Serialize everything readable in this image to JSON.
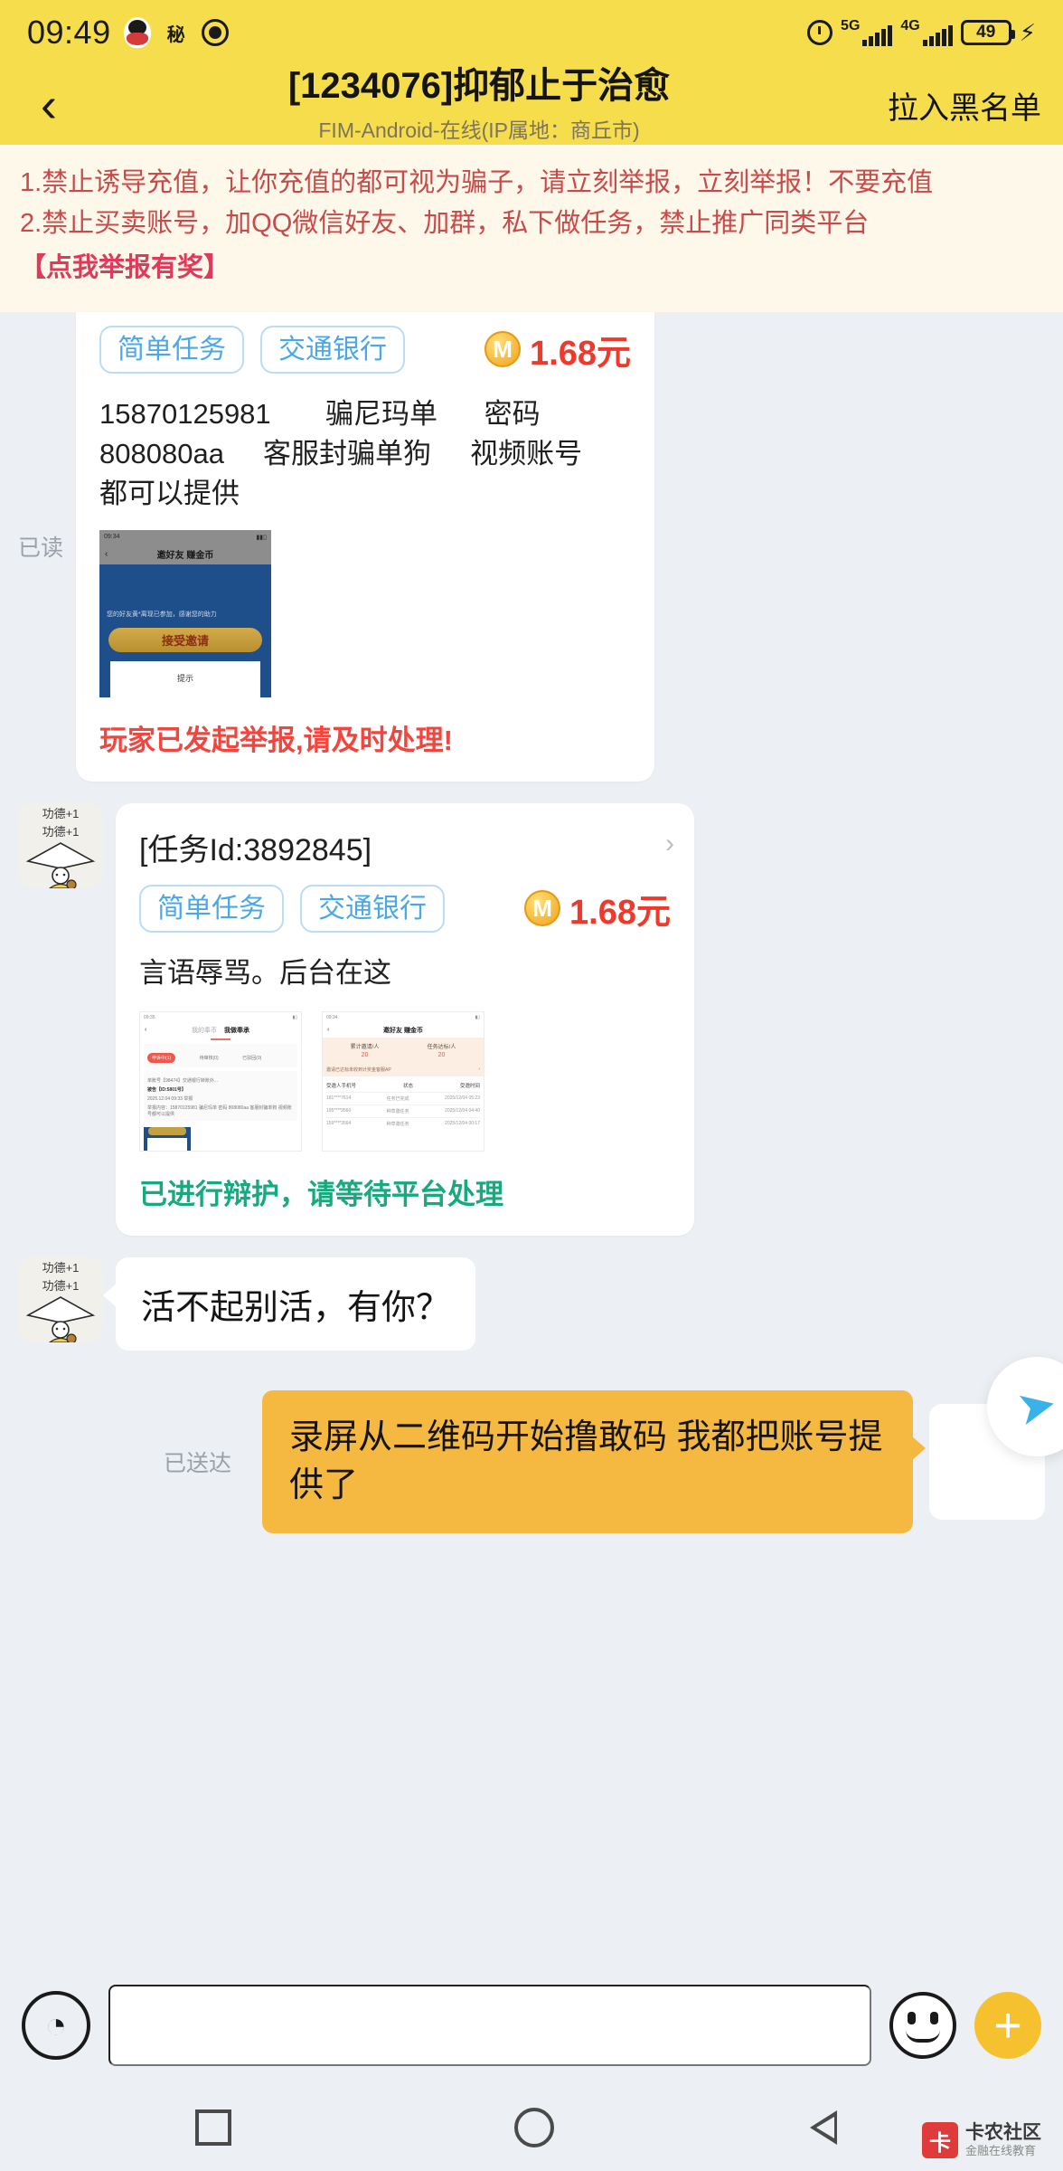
{
  "status_bar": {
    "time": "09:49",
    "icons_left": [
      "qq-icon",
      "secret-icon",
      "eye-icon"
    ],
    "secret_glyph": "秘",
    "alarm_icon": "alarm-icon",
    "network_5g": "5G",
    "network_4g": "4G",
    "battery_level": "49",
    "charging_glyph": "⚡"
  },
  "header": {
    "back_icon": "chevron-left-icon",
    "title": "[1234076]抑郁止于治愈",
    "subtitle": "FIM-Android-在线(IP属地：商丘市)",
    "blacklist_label": "拉入黑名单"
  },
  "notice": {
    "line1": "1.禁止诱导充值，让你充值的都可视为骗子，请立刻举报，立刻举报！不要充值",
    "line2": "2.禁止买卖账号，加QQ微信好友、加群，私下做任务，禁止推广同类平台",
    "reward": "【点我举报有奖】",
    "text_color": "#c94a4a",
    "reward_color": "#e0395a",
    "bg_color": "#fdf8ea"
  },
  "messages": [
    {
      "type": "task-card",
      "read_status": "已读",
      "tags": [
        "简单任务",
        "交通银行"
      ],
      "coin_glyph": "M",
      "price": "1.68元",
      "body": "15870125981       骗尼玛单      密码\n808080aa     客服封骗单狗     视频账号\n都可以提供",
      "thumbnail": {
        "status_time": "09:34",
        "nav_title": "邀好友 赚金币",
        "desc": "您的好友黄*离现已参加，感谢您的助力",
        "button": "接受邀请",
        "sheet_hint": "提示"
      },
      "status_text": "玩家已发起举报,请及时处理!",
      "status_color": "#f2453d"
    },
    {
      "type": "task-card",
      "avatar": "monk-avatar",
      "avatar_text": "功德+1",
      "card_title": "[任务Id:3892845]",
      "chevron_icon": "chevron-right-icon",
      "tags": [
        "简单任务",
        "交通银行"
      ],
      "coin_glyph": "M",
      "price": "1.68元",
      "body": "言语辱骂。后台在这",
      "thumb_left": {
        "status_time": "09:35",
        "tab_inactive": "我的奉币",
        "tab_active": "我做奉承",
        "chip": "申诉中(1)",
        "col2": "待审核(0)",
        "col3": "已驳回(0)",
        "row_label": "举报类型",
        "row_value": "单账号【98474】交通银行转账外...",
        "row_title": "被告【ID:5801号】",
        "row_date": "2025.12.04 09:33 举报",
        "row_body": "举报内容：15870125981    骗尼玛单    密码 808080aa   客服封骗单狗   视频账号都可以提供"
      },
      "thumb_right": {
        "status_time": "09:34",
        "nav_title": "邀好友 赚金币",
        "col1_label": "累计邀请/人",
        "col2_label": "任务达标/人",
        "col1_value": "20",
        "col2_value": "20",
        "notice": "邀请已达标未收到计奖金客服AP",
        "th": [
          "受邀人手机号",
          "状态",
          "受邀时间"
        ],
        "rows": [
          [
            "181****7614",
            "任务已完成",
            "2025/12/04 05:23"
          ],
          [
            "195****9560",
            "种草邀任务",
            "2025/12/04 04:40"
          ],
          [
            "159****3564",
            "种草邀任务",
            "2025/12/04 00:17"
          ]
        ]
      },
      "status_text": "已进行辩护，请等待平台处理",
      "status_color": "#18a97f"
    },
    {
      "type": "text-left",
      "avatar": "monk-avatar",
      "avatar_text": "功德+1",
      "text": "活不起别活，有你？"
    },
    {
      "type": "text-right",
      "delivery_status": "已送达",
      "text": "录屏从二维码开始撸敢码\n我都把账号提供了",
      "bubble_color": "#f5b942"
    }
  ],
  "floating_button": {
    "icon": "paper-plane-icon"
  },
  "input_bar": {
    "voice_icon": "voice-wave-icon",
    "input_value": "",
    "input_placeholder": "",
    "emoji_icon": "emoji-smile-icon",
    "plus_icon": "plus-icon",
    "plus_color": "#f5c12e"
  },
  "nav_bar": {
    "recents_icon": "square-icon",
    "home_icon": "circle-icon",
    "back_icon": "triangle-back-icon",
    "watermark": {
      "logo_glyph": "卡",
      "name": "卡农社区",
      "tagline": "金融在线教育"
    }
  },
  "theme": {
    "header_bg": "#f5dd4b",
    "chat_bg": "#eceff3",
    "tag_color": "#4aa8e8",
    "price_color": "#f0392b"
  }
}
